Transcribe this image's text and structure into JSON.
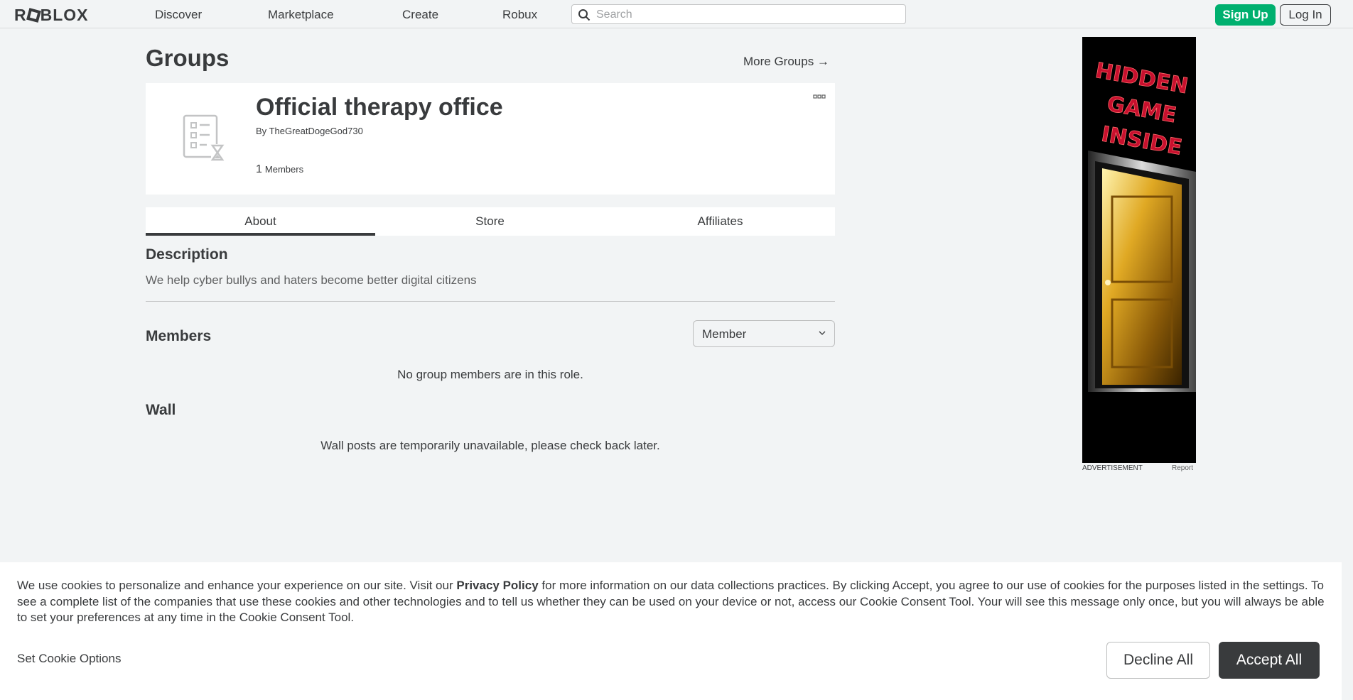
{
  "nav": {
    "logo": "ROBLOX",
    "links": [
      "Discover",
      "Marketplace",
      "Create",
      "Robux"
    ],
    "search_placeholder": "Search",
    "sign_up": "Sign Up",
    "log_in": "Log In"
  },
  "page": {
    "title": "Groups",
    "more_groups": "More Groups →"
  },
  "group": {
    "name": "Official therapy office",
    "owner_prefix": "By",
    "owner": "TheGreatDogeGod730",
    "member_count": "1",
    "member_label": "Members"
  },
  "tabs": [
    "About",
    "Store",
    "Affiliates"
  ],
  "about": {
    "description_heading": "Description",
    "description": "We help cyber bullys and haters become better digital citizens",
    "members_heading": "Members",
    "role_selected": "Member",
    "members_empty": "No group members are in this role.",
    "wall_heading": "Wall",
    "wall_message": "Wall posts are temporarily unavailable, please check back later."
  },
  "ad": {
    "headline": [
      "HIDDEN",
      "GAME",
      "INSIDE"
    ],
    "label": "ADVERTISEMENT",
    "report": "Report"
  },
  "cookie": {
    "text_before": "We use cookies to personalize and enhance your experience on our site. Visit our ",
    "privacy_link": "Privacy Policy",
    "text_after": " for more information on our data collections practices. By clicking Accept, you agree to our use of cookies for the purposes listed in the settings. To see a complete list of the companies that use these cookies and other technologies and to tell us whether they can be used on your device or not, access our Cookie Consent Tool. Your will see this message only once, but you will always be able to set your preferences at any time in the Cookie Consent Tool.",
    "set_options": "Set Cookie Options",
    "decline": "Decline All",
    "accept": "Accept All"
  },
  "colors": {
    "brand_green": "#00b06f",
    "text_dark": "#393b3d",
    "background": "#f2f4f5"
  }
}
